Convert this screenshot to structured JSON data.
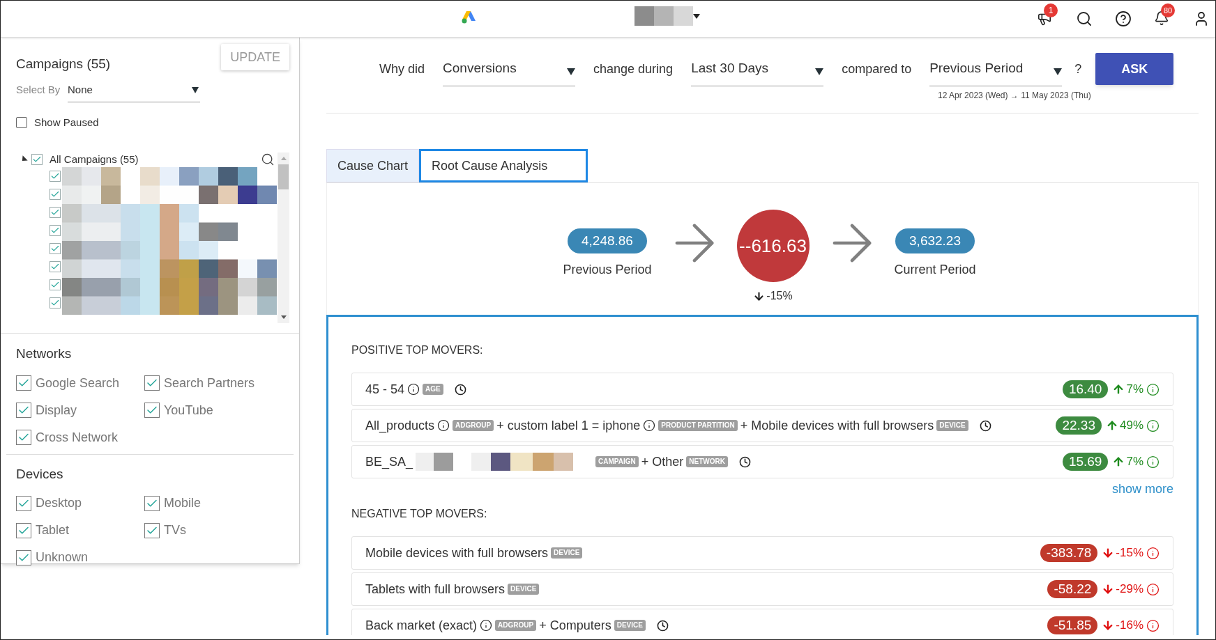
{
  "header": {
    "announcements_badge": "1",
    "notifications_badge": "80"
  },
  "campaigns": {
    "title": "Campaigns (55)",
    "update_button": "UPDATE",
    "select_by": {
      "label": "Select By",
      "value": "None"
    },
    "show_paused": {
      "label": "Show Paused",
      "checked": false
    },
    "tree": {
      "label": "All Campaigns (55)",
      "expanded": true,
      "checked": true,
      "children": [
        {
          "checked": true
        },
        {
          "checked": true
        },
        {
          "checked": true
        },
        {
          "checked": true
        },
        {
          "checked": true
        },
        {
          "checked": true
        },
        {
          "checked": true
        },
        {
          "checked": true
        }
      ]
    }
  },
  "networks": {
    "title": "Networks",
    "options": [
      {
        "label": "Google Search",
        "checked": true
      },
      {
        "label": "Search Partners",
        "checked": true
      },
      {
        "label": "Display",
        "checked": true
      },
      {
        "label": "YouTube",
        "checked": true
      },
      {
        "label": "Cross Network",
        "checked": true
      }
    ]
  },
  "devices": {
    "title": "Devices",
    "options": [
      {
        "label": "Desktop",
        "checked": true
      },
      {
        "label": "Mobile",
        "checked": true
      },
      {
        "label": "Tablet",
        "checked": true
      },
      {
        "label": "TVs",
        "checked": true
      },
      {
        "label": "Unknown",
        "checked": true
      }
    ]
  },
  "query": {
    "why_did": "Why did",
    "metric": "Conversions",
    "change_during": "change during",
    "period": "Last 30 Days",
    "compared_to": "compared to",
    "comparison": "Previous Period",
    "help": "?",
    "date_range": "12 Apr 2023 (Wed) → 11 May 2023 (Thu)",
    "ask_button": "ASK"
  },
  "tabs": [
    {
      "label": "Cause Chart",
      "selected": false
    },
    {
      "label": "Root Cause Analysis",
      "selected": true
    }
  ],
  "flow": {
    "previous": {
      "value": "4,248.86",
      "label": "Previous Period"
    },
    "change": {
      "value": "--616.63",
      "percent": "-15%"
    },
    "current": {
      "value": "3,632.23",
      "label": "Current Period"
    }
  },
  "sections": [
    {
      "kind": "positive",
      "title": "POSITIVE TOP MOVERS:",
      "rows": [
        {
          "value": "16.40",
          "percent": "7%",
          "parts": [
            {
              "kind": "text",
              "text": "45 - 54"
            },
            {
              "kind": "info"
            },
            {
              "kind": "tag",
              "text": "AGE"
            },
            {
              "kind": "clock"
            }
          ]
        },
        {
          "value": "22.33",
          "percent": "49%",
          "parts": [
            {
              "kind": "text",
              "text": "All_products"
            },
            {
              "kind": "info"
            },
            {
              "kind": "tag",
              "text": "ADGROUP"
            },
            {
              "kind": "text",
              "text": "+ custom label 1 = iphone"
            },
            {
              "kind": "info"
            },
            {
              "kind": "tag",
              "text": "PRODUCT PARTITION"
            },
            {
              "kind": "text",
              "text": "+ Mobile devices with full browsers"
            },
            {
              "kind": "tag",
              "text": "DEVICE"
            },
            {
              "kind": "clock"
            }
          ]
        },
        {
          "value": "15.69",
          "percent": "7%",
          "parts": [
            {
              "kind": "text",
              "text": "BE_SA_"
            },
            {
              "kind": "picture"
            },
            {
              "kind": "tag",
              "text": "CAMPAIGN"
            },
            {
              "kind": "text",
              "text": "+ Other"
            },
            {
              "kind": "tag",
              "text": "NETWORK"
            },
            {
              "kind": "clock"
            }
          ]
        }
      ],
      "show_more": "show more"
    },
    {
      "kind": "negative",
      "title": "NEGATIVE TOP MOVERS:",
      "rows": [
        {
          "value": "-383.78",
          "percent": "-15%",
          "parts": [
            {
              "kind": "text",
              "text": "Mobile devices with full browsers"
            },
            {
              "kind": "tag",
              "text": "DEVICE"
            }
          ]
        },
        {
          "value": "-58.22",
          "percent": "-29%",
          "parts": [
            {
              "kind": "text",
              "text": "Tablets with full browsers"
            },
            {
              "kind": "tag",
              "text": "DEVICE"
            }
          ]
        },
        {
          "value": "-51.85",
          "percent": "-16%",
          "parts": [
            {
              "kind": "text",
              "text": "Back market (exact)"
            },
            {
              "kind": "info"
            },
            {
              "kind": "tag",
              "text": "ADGROUP"
            },
            {
              "kind": "text",
              "text": "+ Computers"
            },
            {
              "kind": "tag",
              "text": "DEVICE"
            },
            {
              "kind": "clock"
            }
          ]
        }
      ]
    }
  ]
}
